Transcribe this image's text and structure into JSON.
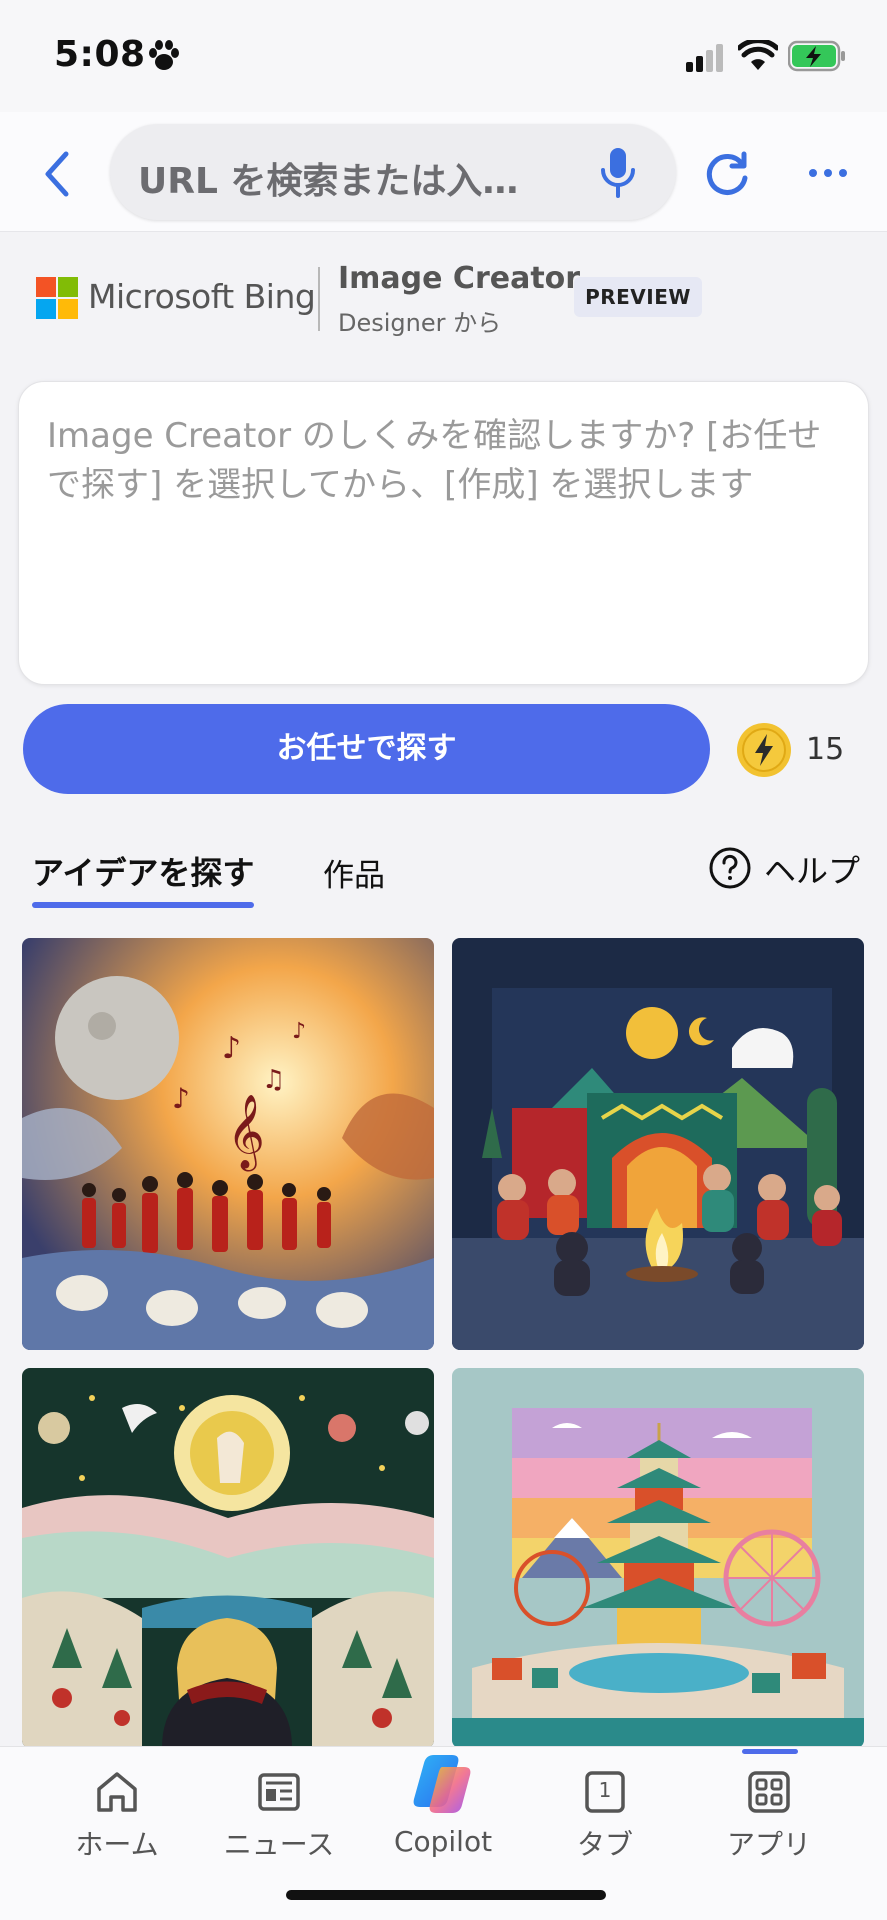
{
  "status_bar": {
    "time": "5:08"
  },
  "browser": {
    "url_placeholder": "URL を検索または入…"
  },
  "header": {
    "brand": "Microsoft Bing",
    "app_title": "Image Creator",
    "app_subtitle": "Designer から",
    "badge": "PREVIEW"
  },
  "prompt": {
    "placeholder": "Image Creator のしくみを確認しますか? [お任せで探す] を選択してから、[作成] を選択します"
  },
  "actions": {
    "surprise_label": "お任せで探す",
    "boost_count": "15"
  },
  "tabs": {
    "ideas": "アイデアを探す",
    "creations": "作品",
    "help": "ヘルプ"
  },
  "gallery": {
    "tiles": [
      "concert-under-moon",
      "felt-campfire-village",
      "felt-night-sky-girl",
      "paper-pagoda-amusement-park"
    ]
  },
  "bottom_nav": {
    "home": "ホーム",
    "news": "ニュース",
    "copilot": "Copilot",
    "tabs": "タブ",
    "tabs_count": "1",
    "apps": "アプリ"
  },
  "colors": {
    "accent": "#4e6bea",
    "background": "#f3f3f6",
    "boost_gold": "#f2c230"
  }
}
